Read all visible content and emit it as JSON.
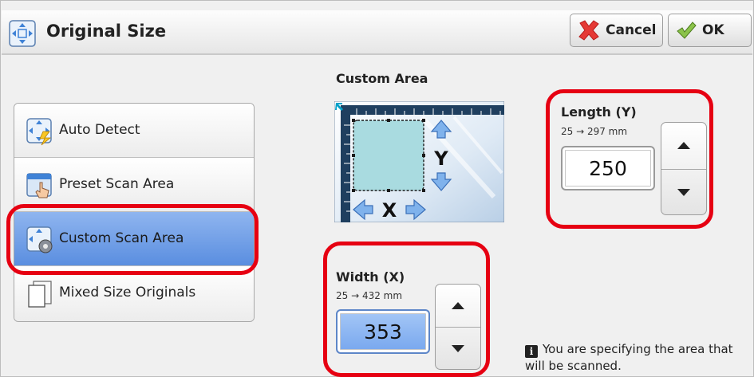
{
  "header": {
    "title": "Original Size",
    "cancel_label": "Cancel",
    "ok_label": "OK"
  },
  "options": [
    {
      "label": "Auto Detect",
      "icon": "auto-detect-icon",
      "selected": false
    },
    {
      "label": "Preset Scan Area",
      "icon": "preset-scan-area-icon",
      "selected": false
    },
    {
      "label": "Custom Scan Area",
      "icon": "custom-scan-area-icon",
      "selected": true
    },
    {
      "label": "Mixed Size Originals",
      "icon": "mixed-size-originals-icon",
      "selected": false
    }
  ],
  "custom_area": {
    "label": "Custom Area",
    "diagram_x": "X",
    "diagram_y": "Y"
  },
  "length": {
    "title": "Length (Y)",
    "range": "25 → 297 mm",
    "value": "250"
  },
  "width": {
    "title": "Width (X)",
    "range": "25 → 432 mm",
    "value": "353"
  },
  "note": {
    "icon": "i",
    "text": "You are specifying the area that will be scanned."
  },
  "colors": {
    "highlight_red": "#e60012",
    "selected_blue": "#5a8ee0"
  }
}
